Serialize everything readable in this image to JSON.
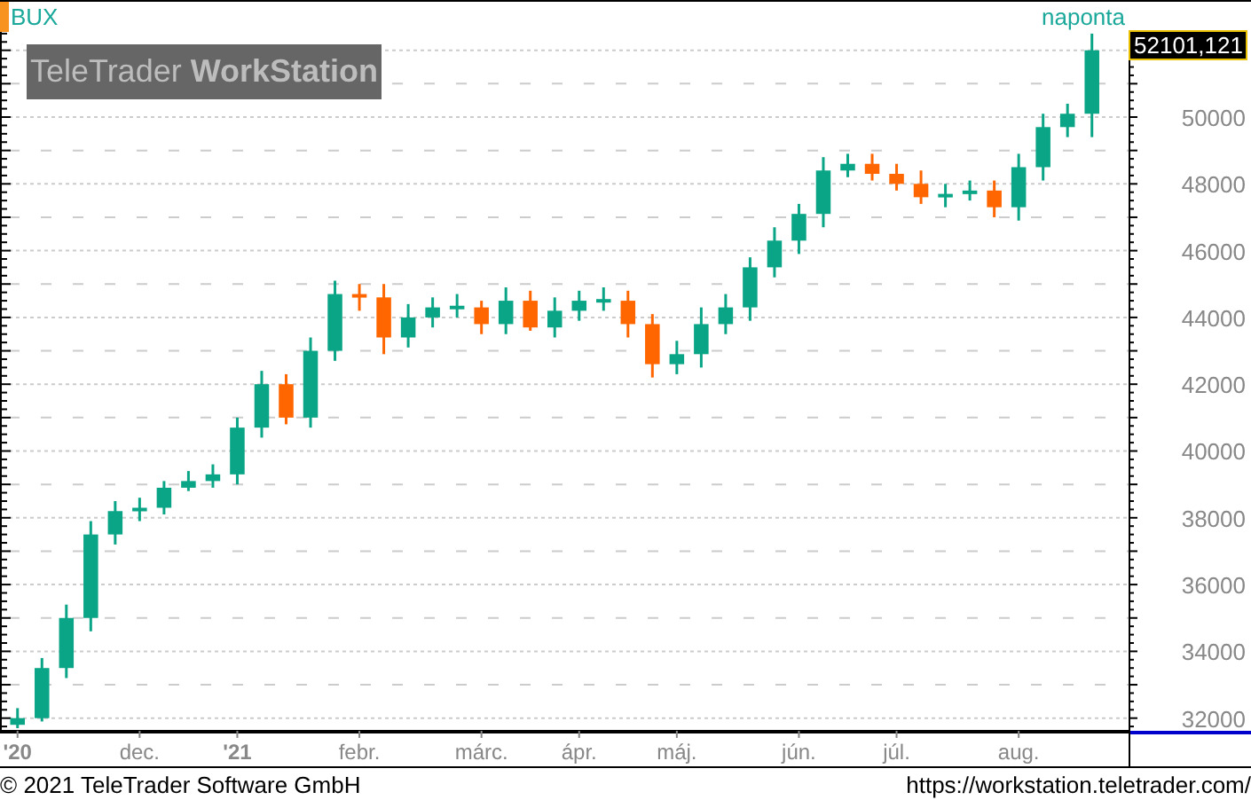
{
  "interval": "naponta",
  "logo": "TeleTrader **WorkStation**",
  "last_price": "52101,121",
  "chart": {
    "chart_data": {
      "type": "candlestick",
      "categories": [
        "'20",
        null,
        null,
        null,
        null,
        "dec.",
        null,
        null,
        null,
        "'21",
        null,
        null,
        null,
        null,
        "febr.",
        null,
        null,
        null,
        null,
        "márc.",
        null,
        null,
        null,
        "ápr.",
        null,
        null,
        null,
        "máj.",
        null,
        null,
        null,
        null,
        "jún.",
        null,
        null,
        null,
        "júl.",
        null,
        null,
        null,
        null,
        "aug.",
        null,
        null,
        null
      ],
      "grid": true,
      "series": [
        {
          "name": "BUX",
          "ohlc": [
            [
              31800,
              32300,
              31700,
              32000
            ],
            [
              32000,
              33800,
              31900,
              33500
            ],
            [
              33500,
              35400,
              33200,
              35000
            ],
            [
              35000,
              37900,
              34600,
              37500
            ],
            [
              37500,
              38500,
              37200,
              38200
            ],
            [
              38200,
              38600,
              37900,
              38300
            ],
            [
              38300,
              39100,
              38100,
              38900
            ],
            [
              38900,
              39400,
              38800,
              39100
            ],
            [
              39100,
              39600,
              38900,
              39300
            ],
            [
              39300,
              41000,
              39000,
              40700
            ],
            [
              40700,
              42400,
              40400,
              42000
            ],
            [
              42000,
              42300,
              40800,
              41000
            ],
            [
              41000,
              43400,
              40700,
              43000
            ],
            [
              43000,
              45100,
              42700,
              44700
            ],
            [
              44700,
              45000,
              44200,
              44600
            ],
            [
              44600,
              45000,
              42900,
              43400
            ],
            [
              43400,
              44400,
              43100,
              44000
            ],
            [
              44000,
              44600,
              43700,
              44300
            ],
            [
              44300,
              44700,
              44000,
              44350
            ],
            [
              44300,
              44500,
              43500,
              43800
            ],
            [
              43800,
              44900,
              43500,
              44500
            ],
            [
              44500,
              44800,
              43600,
              43700
            ],
            [
              43700,
              44600,
              43400,
              44200
            ],
            [
              44200,
              44800,
              43900,
              44500
            ],
            [
              44500,
              44900,
              44200,
              44550
            ],
            [
              44500,
              44800,
              43400,
              43800
            ],
            [
              43800,
              44100,
              42200,
              42600
            ],
            [
              42600,
              43300,
              42300,
              42900
            ],
            [
              42900,
              44300,
              42500,
              43800
            ],
            [
              43800,
              44700,
              43500,
              44300
            ],
            [
              44300,
              45800,
              43900,
              45500
            ],
            [
              45500,
              46700,
              45200,
              46300
            ],
            [
              46300,
              47400,
              45900,
              47100
            ],
            [
              47100,
              48800,
              46700,
              48400
            ],
            [
              48400,
              48900,
              48200,
              48600
            ],
            [
              48600,
              48900,
              48100,
              48300
            ],
            [
              48300,
              48600,
              47800,
              48000
            ],
            [
              48000,
              48400,
              47400,
              47600
            ],
            [
              47600,
              48000,
              47300,
              47700
            ],
            [
              47700,
              48100,
              47500,
              47800
            ],
            [
              47800,
              48100,
              47000,
              47300
            ],
            [
              47300,
              48900,
              46900,
              48500
            ],
            [
              48500,
              50100,
              48100,
              49700
            ],
            [
              49700,
              50400,
              49400,
              50100
            ],
            [
              50100,
              52500,
              49400,
              52000
            ]
          ]
        }
      ],
      "ylim": [
        31620,
        52550
      ],
      "yticks": [
        32000,
        34000,
        36000,
        38000,
        40000,
        42000,
        44000,
        46000,
        48000,
        50000
      ]
    }
  },
  "footer": {
    "copyright": "© 2021 TeleTrader Software GmbH",
    "url": "https://workstation.teletrader.com/"
  }
}
